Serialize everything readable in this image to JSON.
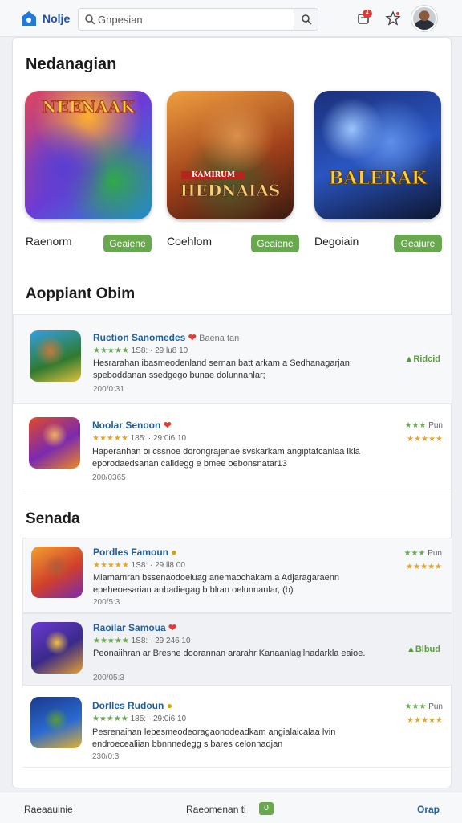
{
  "header": {
    "brand": "Nolje",
    "search_value": "Gnpesian",
    "notification_count": "4",
    "icons": {
      "logo": "home-logo-icon",
      "search": "search-icon",
      "notifications": "bell-icon",
      "favorites": "star-icon",
      "avatar": "user-avatar"
    }
  },
  "featured": {
    "title": "Nedanagian",
    "items": [
      {
        "art_title": "NEENAAK",
        "name": "Raenorm",
        "button": "Geaiene"
      },
      {
        "art_title": "HEDNAIAS",
        "art_banner": "KAMIRUM",
        "name": "Coehlom",
        "button": "Geaiene"
      },
      {
        "art_title": "BALERAK",
        "name": "Degoiain",
        "button": "Geaiure"
      }
    ]
  },
  "section2": {
    "title": "Aoppiant Obim",
    "rows": [
      {
        "name": "Ruction Sanomedes",
        "extra": "Baena tan",
        "stars": "★★★★★",
        "meta": "1S8: · 29 lu8 10",
        "desc": "Hesrarahan ibasmeodenland sernan batt arkam a Sedhanagarjan: speboddanan ssedgego bunae dolunnanlar;",
        "date": "200/0:31",
        "status": "Ridcid"
      },
      {
        "name": "Noolar Senoon",
        "stars": "★★★★★",
        "meta": "185: · 29:0i6 10",
        "desc": "Haperanhan oi cssnoe dorongrajenae svskarkam angiptafcanlaa lkla eporodaedsanan calidegg e bmee oebonsnatar13",
        "date": "200/0365",
        "rating_label": "Pun",
        "rating_top": "★★★",
        "rating_bottom": "★★★★★"
      }
    ]
  },
  "section3": {
    "title": "Senada",
    "rows": [
      {
        "name": "Pordles Famoun",
        "stars": "★★★★★",
        "meta": "1S8: · 29 ll8 00",
        "desc": "Mlamamran bssenaodoeiuag anemaochakam a Adjaragaraenn epeheoesarian anbadiegag b blran oelunnanlar, (b)",
        "date": "200/5:3",
        "rating_label": "Pun",
        "rating_top": "★★★",
        "rating_bottom": "★★★★★"
      },
      {
        "name": "Raoilar Samoua",
        "stars": "★★★★★",
        "meta": "1S8: · 29 246 10",
        "desc": "Peonaiihran ar Bresne doorannan ararahr Kanaanlagilnadarkla eaioe.",
        "date": "200/05:3",
        "status": "Blbud"
      },
      {
        "name": "Dorlles Rudoun",
        "stars": "★★★★★",
        "meta": "185: · 29:0i6 10",
        "desc": "Pesrenaihan lebesmeodeoragaonodeadkam angialaicalaa lvin endroecealiian bbnnnedegg s bares celonnadjan",
        "date": "230/0:3",
        "rating_label": "Pun",
        "rating_top": "★★★",
        "rating_bottom": "★★★★★"
      }
    ]
  },
  "footer": {
    "left": "Raeaauinie",
    "middle": "Raeomenan ti",
    "badge": "0",
    "right": "Orap"
  },
  "colors": {
    "accent_green": "#6aa84f",
    "link_blue": "#1f5fa0",
    "heart_red": "#e53935"
  }
}
